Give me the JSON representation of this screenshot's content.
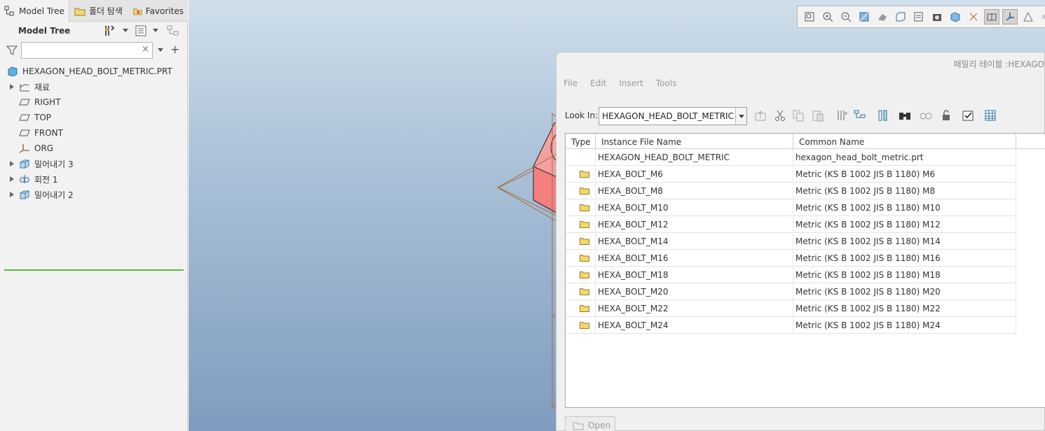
{
  "tabs": [
    {
      "label": "Model Tree",
      "icon": "model-tree-icon"
    },
    {
      "label": "폴더 탐색",
      "icon": "folder-browser-icon"
    },
    {
      "label": "Favorites",
      "icon": "favorites-icon"
    }
  ],
  "model_tree": {
    "title": "Model Tree",
    "search_value": "",
    "search_clear": "×",
    "add_symbol": "+",
    "root": "HEXAGON_HEAD_BOLT_METRIC.PRT",
    "items": [
      {
        "label": "재료",
        "icon": "material-icon",
        "expandable": true
      },
      {
        "label": "RIGHT",
        "icon": "datum-plane-icon",
        "expandable": false
      },
      {
        "label": "TOP",
        "icon": "datum-plane-icon",
        "expandable": false
      },
      {
        "label": "FRONT",
        "icon": "datum-plane-icon",
        "expandable": false
      },
      {
        "label": "ORG",
        "icon": "coordinate-system-icon",
        "expandable": false
      },
      {
        "label": "밀어내기 3",
        "icon": "extrude-icon",
        "expandable": true
      },
      {
        "label": "회전 1",
        "icon": "revolve-icon",
        "expandable": true
      },
      {
        "label": "밀어내기 2",
        "icon": "extrude-icon",
        "expandable": true
      }
    ]
  },
  "view_toolbar": {
    "icons": [
      "refit-icon",
      "zoom-in-icon",
      "zoom-out-icon",
      "repaint-icon",
      "display-style-icon",
      "saved-orientations-icon",
      "view-manager-icon",
      "perspective-icon",
      "section-icon",
      "datum-display-icon",
      "plane-display-icon",
      "csys-display-icon",
      "annotation-display-icon",
      "spin-center-icon"
    ],
    "active": [
      10,
      11
    ]
  },
  "family_table": {
    "title": "패밀리 테이블 :HEXAGO",
    "menu": [
      "File",
      "Edit",
      "Insert",
      "Tools"
    ],
    "look_in_label": "Look In:",
    "look_in_value": "HEXAGON_HEAD_BOLT_METRIC",
    "toolbar_icons": [
      "up-level-icon",
      "cut-icon",
      "copy-icon",
      "paste-icon",
      "sort-icon",
      "tree-view-icon",
      "columns-icon",
      "find-icon",
      "preview-icon",
      "lock-icon",
      "verify-icon",
      "table-icon"
    ],
    "columns": [
      "Type",
      "Instance File Name",
      "Common Name"
    ],
    "rows": [
      {
        "type": "",
        "name": "HEXAGON_HEAD_BOLT_METRIC",
        "common": "hexagon_head_bolt_metric.prt"
      },
      {
        "type": "folder",
        "name": "HEXA_BOLT_M6",
        "common": "Metric (KS B 1002 JIS B 1180) M6"
      },
      {
        "type": "folder",
        "name": "HEXA_BOLT_M8",
        "common": "Metric (KS B 1002 JIS B 1180) M8"
      },
      {
        "type": "folder",
        "name": "HEXA_BOLT_M10",
        "common": "Metric (KS B 1002 JIS B 1180) M10"
      },
      {
        "type": "folder",
        "name": "HEXA_BOLT_M12",
        "common": "Metric (KS B 1002 JIS B 1180) M12"
      },
      {
        "type": "folder",
        "name": "HEXA_BOLT_M14",
        "common": "Metric (KS B 1002 JIS B 1180) M14"
      },
      {
        "type": "folder",
        "name": "HEXA_BOLT_M16",
        "common": "Metric (KS B 1002 JIS B 1180) M16"
      },
      {
        "type": "folder",
        "name": "HEXA_BOLT_M18",
        "common": "Metric (KS B 1002 JIS B 1180) M18"
      },
      {
        "type": "folder",
        "name": "HEXA_BOLT_M20",
        "common": "Metric (KS B 1002 JIS B 1180) M20"
      },
      {
        "type": "folder",
        "name": "HEXA_BOLT_M22",
        "common": "Metric (KS B 1002 JIS B 1180) M22"
      },
      {
        "type": "folder",
        "name": "HEXA_BOLT_M24",
        "common": "Metric (KS B 1002 JIS B 1180) M24"
      }
    ],
    "open_label": "Open"
  },
  "colors": {
    "accent_green": "#5cb83c",
    "bolt_fill": "#f47f7f",
    "datum_plane": "#a0703a",
    "folder": "#f5d86a"
  }
}
